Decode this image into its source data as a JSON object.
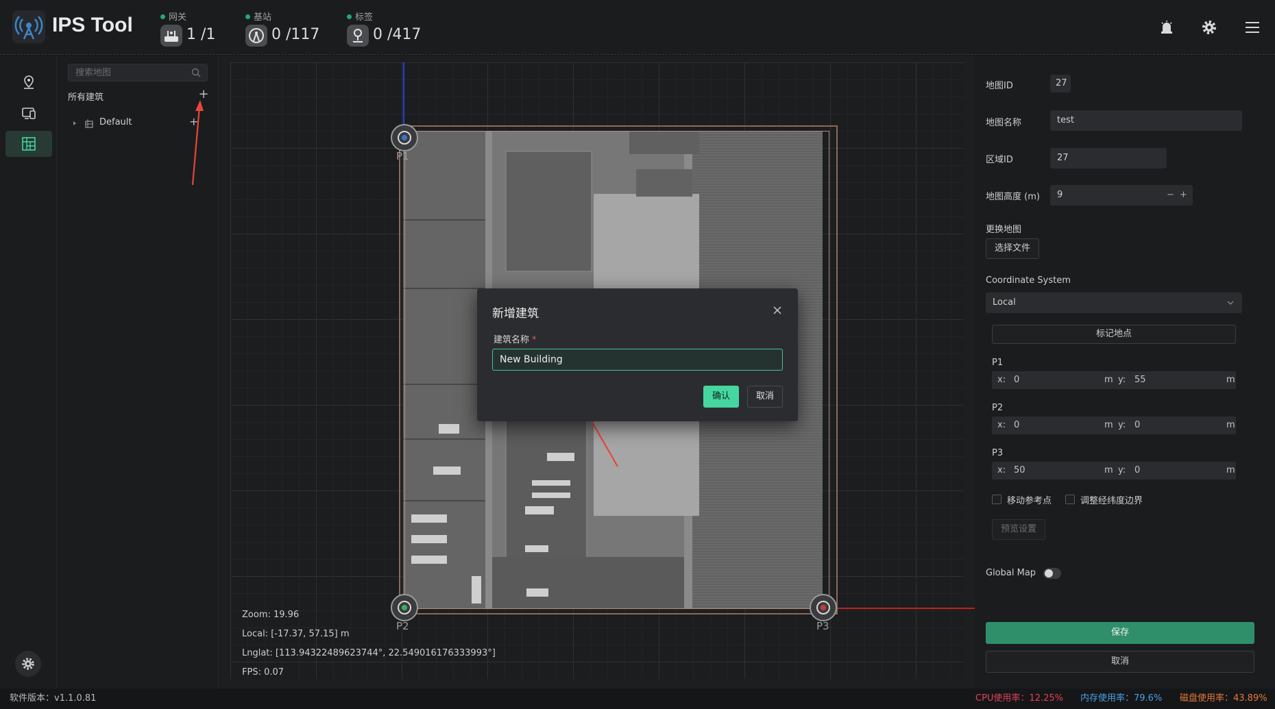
{
  "app": {
    "title": "IPS Tool",
    "logo_icon": "antenna-icon"
  },
  "header": {
    "stats": [
      {
        "label": "网关",
        "value": "1 /1",
        "icon": "router-icon"
      },
      {
        "label": "基站",
        "value": "0 /117",
        "icon": "base-station-icon"
      },
      {
        "label": "标签",
        "value": "0 /417",
        "icon": "tag-location-icon"
      }
    ],
    "actions": [
      "alarm-icon",
      "gear-icon",
      "menu-icon"
    ]
  },
  "rail": {
    "items": [
      "map-pin-icon",
      "devices-icon",
      "buildings-icon"
    ],
    "active": 2
  },
  "tree": {
    "search_placeholder": "搜索地图",
    "section_label": "所有建筑",
    "add_label": "+",
    "items": [
      {
        "label": "Default",
        "add_label": "+"
      }
    ]
  },
  "map": {
    "points": [
      "P1",
      "P2",
      "P3"
    ],
    "zoom": "Zoom:  19.96",
    "local": "Local:  [-17.37,  57.15] m",
    "lnglat": "Lnglat:  [113.94322489623744°,  22.549016176333993°]",
    "fps": "FPS:  0.07"
  },
  "props": {
    "map_id_label": "地图ID",
    "map_id": "27",
    "map_name_label": "地图名称",
    "map_name": "test",
    "area_id_label": "区域ID",
    "area_id": "27",
    "height_label": "地图高度 (m)",
    "height": "9",
    "replace_map_label": "更换地图",
    "choose_file": "选择文件",
    "coord_system_label": "Coordinate System",
    "coord_system": "Local",
    "mark_location": "标记地点",
    "points": [
      {
        "name": "P1",
        "x": "0",
        "y": "55"
      },
      {
        "name": "P2",
        "x": "0",
        "y": "0"
      },
      {
        "name": "P3",
        "x": "50",
        "y": "0"
      }
    ],
    "x_prefix": "x:",
    "y_prefix": "y:",
    "unit": "m",
    "move_ref_label": "移动参考点",
    "adjust_bounds_label": "调整经纬度边界",
    "preview_settings": "预览设置",
    "global_map_label": "Global Map",
    "save": "保存",
    "cancel": "取消"
  },
  "footer": {
    "version": "软件版本：v1.1.0.81",
    "cpu": "CPU使用率：12.25%",
    "memory": "内存使用率：79.6%",
    "disk": "磁盘使用率：43.89%"
  },
  "modal": {
    "title": "新增建筑",
    "field_label": "建筑名称",
    "required_mark": "*",
    "input_value": "New Building",
    "confirm": "确认",
    "cancel": "取消"
  },
  "colors": {
    "accent": "#46d6a1",
    "save": "#2f8f6a",
    "cpu": "#e0435a",
    "memory": "#4ba0e8",
    "disk": "#e27a3d"
  }
}
